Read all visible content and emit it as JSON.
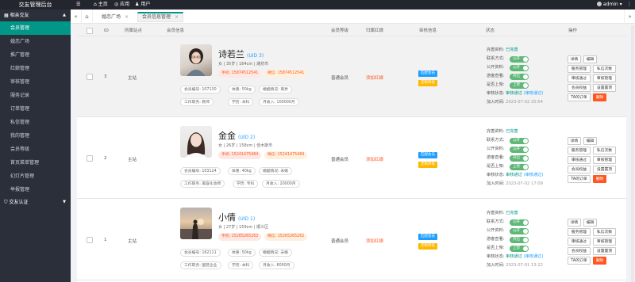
{
  "topbar": {
    "title": "交友管理后台",
    "menu_icon": "☰",
    "nav": [
      {
        "icon": "⌂",
        "label": "主页"
      },
      {
        "icon": "◎",
        "label": "应用"
      },
      {
        "icon": "♟",
        "label": "用户"
      }
    ],
    "user": "admin",
    "user_caret": "▾",
    "more": "⋮"
  },
  "sidebar": {
    "group1": {
      "icon": "▦",
      "label": "相亲交友",
      "arrow": "▲"
    },
    "items": [
      "会员管理",
      "婚恋广场",
      "推广管理",
      "红娘管理",
      "审核管理",
      "服务记录",
      "订单管理",
      "私信管理",
      "我的管理",
      "会员等级",
      "首页菜单管理",
      "幻灯片管理",
      "举报管理"
    ],
    "group2": {
      "icon": "⛉",
      "label": "交友认证",
      "arrow": "▼"
    }
  },
  "tabbar": {
    "prev": "«",
    "home": "⌂",
    "tabs": [
      {
        "label": "婚恋广场"
      },
      {
        "label": "会员信息管理"
      }
    ],
    "close": "×",
    "next": "»"
  },
  "table": {
    "headers": [
      "ID",
      "所属站点",
      "会员信息",
      "会员等级",
      "归属红娘",
      "审核信息",
      "状态",
      "操作"
    ],
    "rows": [
      {
        "id": "3",
        "site": "主站",
        "name": "诗若兰",
        "uid": "(UID 3)",
        "basic": "女  |  35岁  |  164cm  |  潍坊市",
        "phone": "手机: 15874512541",
        "wechat": "微信: 15874512541",
        "member_no": "会员编号: 107130",
        "weight": "体重: 50kg",
        "marriage": "婚姻情况: 离异",
        "job": "工作职务: 教师",
        "edu": "学历: 本科",
        "income": "月收入: 100000月",
        "level": "普通会员",
        "matchmaker": "添加红娘",
        "audit_btn1": "匹配会员",
        "audit_btn2": "定制审核",
        "status": {
          "complete_label": "完善资料:",
          "complete": "已完善",
          "contact": "联系方式:",
          "public": "公开资料:",
          "guest": "游客查看:",
          "home": "是否上架:",
          "audit_label": "审核状态:",
          "audit": "审核通过",
          "audit_by": "(审核通过)",
          "join_label": "加入时间:",
          "join": "2023-07-02 20:54",
          "switch_on": "公开",
          "switch_open": "开启",
          "switch_up": "上架"
        },
        "ops": [
          "详情",
          "编辑",
          "服务管理",
          "私信次数",
          "审核通过",
          "审核管理",
          "会员权益",
          "设置置顶",
          "TA的订单",
          "删除"
        ]
      },
      {
        "id": "2",
        "site": "主站",
        "name": "金金",
        "uid": "(UID 2)",
        "basic": "女  |  26岁  |  158cm  |  佳木斯市",
        "phone": "手机: 15241475484",
        "wechat": "微信: 15241475484",
        "member_no": "会员编号: 103124",
        "weight": "体重: 40kg",
        "marriage": "婚姻情况: 未婚",
        "job": "工作职务: 美容化妆师",
        "edu": "学历: 专科",
        "income": "月收入: 20000月",
        "level": "普通会员",
        "matchmaker": "添加红娘",
        "audit_btn1": "匹配会员",
        "audit_btn2": "定制审核",
        "status": {
          "complete_label": "完善资料:",
          "complete": "已完善",
          "contact": "联系方式:",
          "public": "公开资料:",
          "guest": "游客查看:",
          "home": "是否上架:",
          "audit_label": "审核状态:",
          "audit": "审核通过",
          "audit_by": "(审核通过)",
          "join_label": "加入时间:",
          "join": "2023-07-02 17:09",
          "switch_on": "公开",
          "switch_open": "开启",
          "switch_up": "上架"
        },
        "ops": [
          "详情",
          "编辑",
          "服务管理",
          "私信次数",
          "审核通过",
          "审核管理",
          "会员权益",
          "设置置顶",
          "TA的订单",
          "删除"
        ]
      },
      {
        "id": "1",
        "site": "主站",
        "name": "小倩",
        "uid": "(UID 1)",
        "basic": "女  |  27岁  |  159cm  |  顺义区",
        "phone": "手机: 15265265262",
        "wechat": "微信: 15265265262",
        "member_no": "会员编号: 162111",
        "weight": "体重: 50kg",
        "marriage": "婚姻情况: 未婚",
        "job": "工作职务: 国营企业",
        "edu": "学历: 本科",
        "income": "月收入: 8000月",
        "level": "普通会员",
        "matchmaker": "添加红娘",
        "audit_btn1": "匹配会员",
        "audit_btn2": "定制审核",
        "status": {
          "complete_label": "完善资料:",
          "complete": "已完善",
          "contact": "联系方式:",
          "public": "公开资料:",
          "guest": "游客查看:",
          "home": "是否上架:",
          "audit_label": "审核状态:",
          "audit": "审核通过",
          "audit_by": "(审核通过)",
          "join_label": "加入时间:",
          "join": "2023-07-01 13:22",
          "switch_on": "公开",
          "switch_open": "开启",
          "switch_up": "上架"
        },
        "ops": [
          "详情",
          "编辑",
          "服务管理",
          "私信次数",
          "审核通过",
          "审核管理",
          "会员权益",
          "设置置顶",
          "TA的订单",
          "删除"
        ]
      }
    ]
  },
  "colors": {
    "accent": "#009688",
    "link": "#1e9fff",
    "warn": "#ff5722",
    "orange": "#ffb800",
    "switch": "#5fb878"
  }
}
